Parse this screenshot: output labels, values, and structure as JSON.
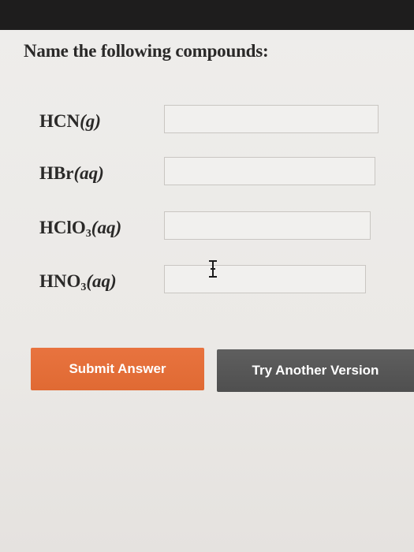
{
  "question": "Name the following compounds:",
  "compounds": [
    {
      "main": "HCN",
      "sub": "",
      "state": "(g)",
      "answer": ""
    },
    {
      "main": "HBr",
      "sub": "",
      "state": "(aq)",
      "answer": ""
    },
    {
      "main": "HClO",
      "sub": "3",
      "state": "(aq)",
      "answer": ""
    },
    {
      "main": "HNO",
      "sub": "3",
      "state": "(aq)",
      "answer": ""
    }
  ],
  "buttons": {
    "submit": "Submit Answer",
    "try_another": "Try Another Version"
  },
  "colors": {
    "submit": "#e06a33",
    "try_another": "#555555",
    "top_bar": "#1e1d1d"
  },
  "icons": {
    "cursor": "text-cursor-icon"
  }
}
